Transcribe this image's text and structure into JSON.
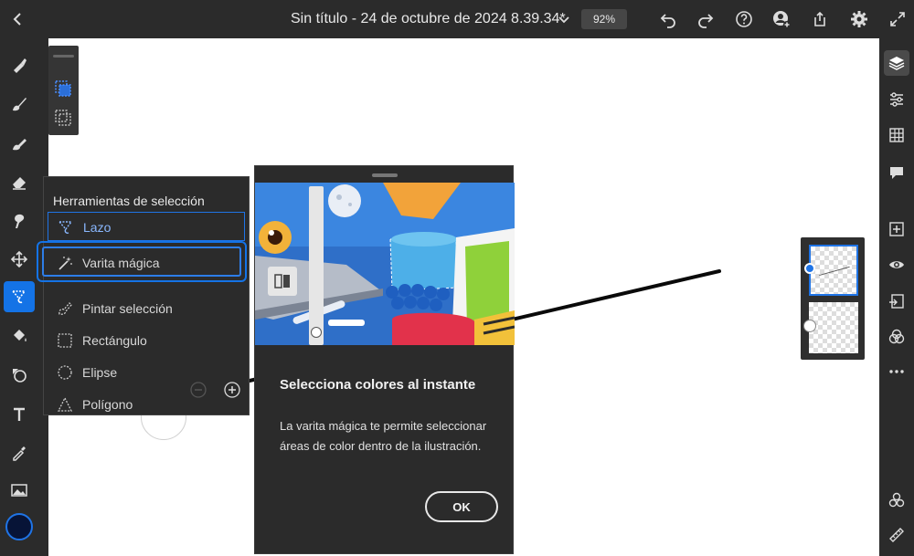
{
  "topbar": {
    "title": "Sin título - 24 de octubre de 2024 8.39.34*",
    "zoom": "92%",
    "icons": [
      "back-icon",
      "chevron-down-icon",
      "undo-icon",
      "redo-icon",
      "help-icon",
      "add-user-icon",
      "share-icon",
      "settings-icon",
      "fullscreen-icon"
    ]
  },
  "left_toolbar": {
    "tools": [
      "pixel-brush-icon",
      "live-brush-icon",
      "vector-brush-icon",
      "eraser-icon",
      "smudge-icon",
      "move-icon",
      "selection-icon",
      "fill-icon",
      "shape-icon",
      "text-icon",
      "eyedropper-icon",
      "image-icon"
    ],
    "active_tool": "selection-icon",
    "color": "#071437"
  },
  "selection_menu": {
    "title": "Herramientas de selección",
    "items": [
      {
        "label": "Lazo",
        "icon": "lasso-icon"
      },
      {
        "label": "Varita mágica",
        "icon": "magic-wand-icon"
      },
      {
        "label": "Pintar selección",
        "icon": "paint-selection-icon"
      },
      {
        "label": "Rectángulo",
        "icon": "rectangle-select-icon"
      },
      {
        "label": "Elipse",
        "icon": "ellipse-select-icon"
      },
      {
        "label": "Polígono",
        "icon": "polygon-select-icon"
      }
    ]
  },
  "tip": {
    "title": "Selecciona colores al instante",
    "body": "La varita mágica te permite seleccionar áreas de color dentro de la ilustración.",
    "ok_label": "OK"
  },
  "right_toolbar": {
    "icons": [
      "layers-icon",
      "adjustments-icon",
      "grid-icon",
      "comments-icon",
      "add-layer-icon",
      "visibility-icon",
      "import-icon",
      "blend-icon",
      "more-icon",
      "libraries-icon",
      "ruler-icon"
    ]
  },
  "colors": {
    "accent": "#1473e6",
    "panel": "#2b2b2b",
    "canvas": "#ffffff"
  }
}
